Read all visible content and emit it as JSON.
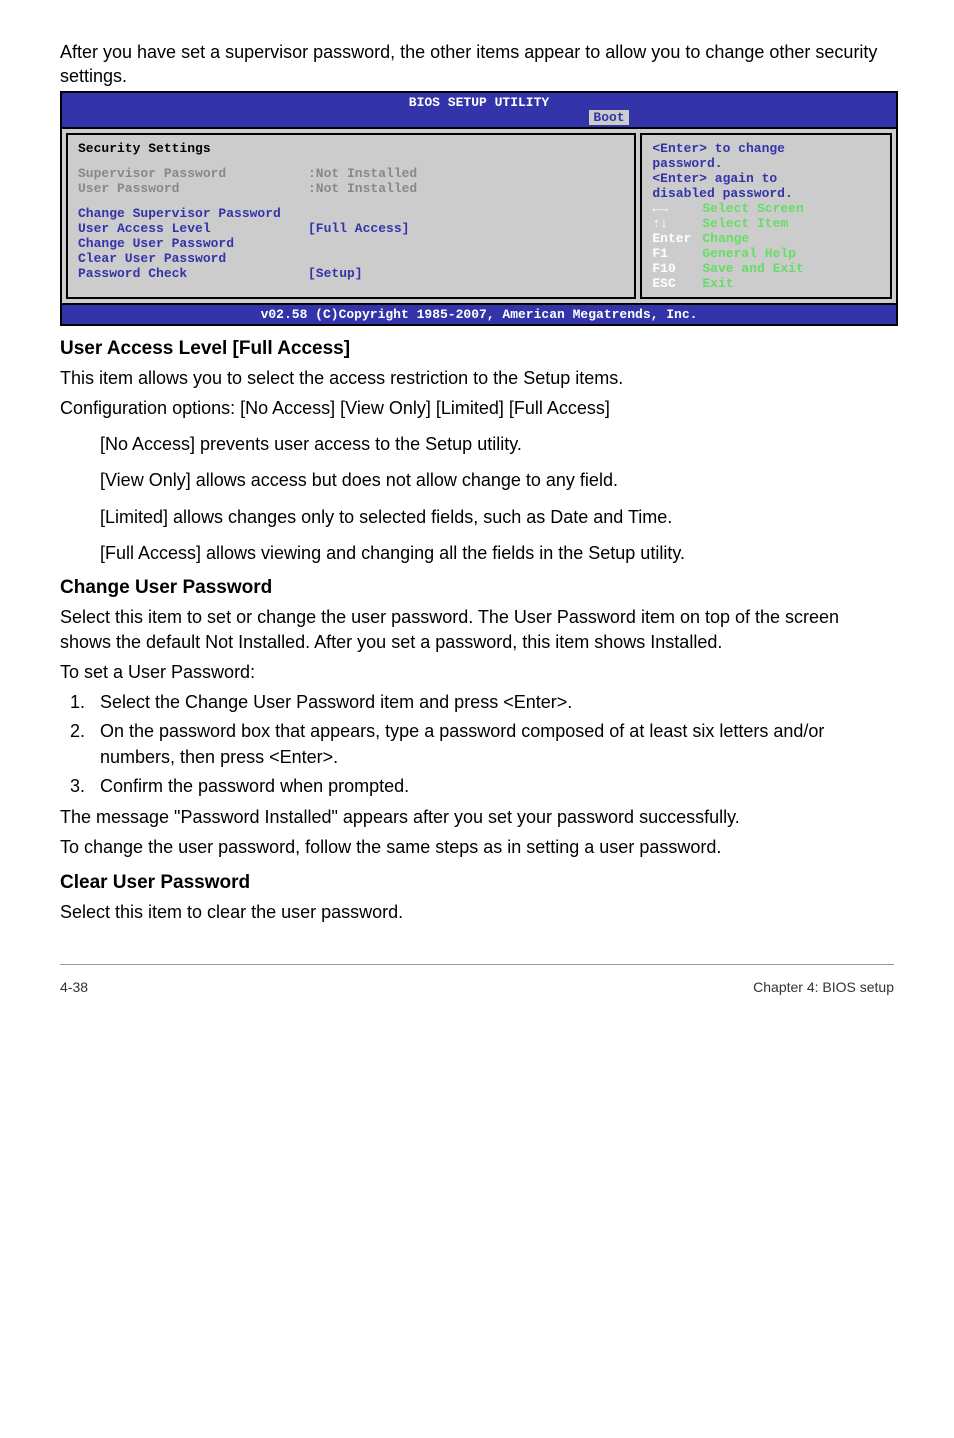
{
  "intro": "After you have set a supervisor password, the other items appear to allow you to change other security settings.",
  "bios": {
    "title": "BIOS SETUP UTILITY",
    "tab": "Boot",
    "left": {
      "heading": "Security Settings",
      "rows_grey": [
        {
          "label": "Supervisor Password",
          "value": ":Not Installed"
        },
        {
          "label": "User Password",
          "value": ":Not Installed"
        }
      ],
      "rows_blue": [
        {
          "label": "Change Supervisor Password",
          "value": ""
        },
        {
          "label": "User Access Level",
          "value": "[Full Access]"
        },
        {
          "label": "Change User Password",
          "value": ""
        },
        {
          "label": "Clear User Password",
          "value": ""
        },
        {
          "label": "Password Check",
          "value": "[Setup]"
        }
      ]
    },
    "right": {
      "help": [
        "<Enter> to change",
        "password.",
        "<Enter> again to",
        "disabled password."
      ],
      "nav": [
        {
          "key": "←→",
          "desc": "Select Screen",
          "sym": "lr"
        },
        {
          "key": "↑↓",
          "desc": "Select Item",
          "sym": "ud"
        },
        {
          "key": "Enter",
          "desc": "Change"
        },
        {
          "key": "F1",
          "desc": "General Help"
        },
        {
          "key": "F10",
          "desc": "Save and Exit"
        },
        {
          "key": "ESC",
          "desc": "Exit"
        }
      ]
    },
    "footer": "v02.58 (C)Copyright 1985-2007, American Megatrends, Inc."
  },
  "sections": {
    "ual_heading": "User Access Level [Full Access]",
    "ual_p1": "This item allows you to select the access restriction to the Setup items.",
    "ual_p2": "Configuration options: [No Access] [View Only] [Limited] [Full Access]",
    "ual_opts": [
      "[No Access] prevents user access to the Setup utility.",
      "[View Only] allows access but does not allow change to any field.",
      "[Limited] allows changes only to selected fields, such as Date and Time.",
      "[Full Access] allows viewing and changing all the fields in the Setup utility."
    ],
    "cup_heading": "Change User Password",
    "cup_p1": "Select this item to set or change the user password. The User Password item on top of the screen shows the default Not Installed. After you set a password, this item shows Installed.",
    "cup_p2": "To set a User Password:",
    "cup_steps": [
      "Select the Change User Password item and press <Enter>.",
      "On the password box that appears, type a password composed of at least six letters and/or numbers, then press <Enter>.",
      "Confirm the password when prompted."
    ],
    "cup_p3": "The message \"Password Installed\" appears after you set your password successfully.",
    "cup_p4": "To change the user password, follow the same steps as in setting a user password.",
    "clear_heading": "Clear User Password",
    "clear_p1": "Select this item to clear the user password."
  },
  "footer": {
    "left": "4-38",
    "right": "Chapter 4: BIOS setup"
  }
}
